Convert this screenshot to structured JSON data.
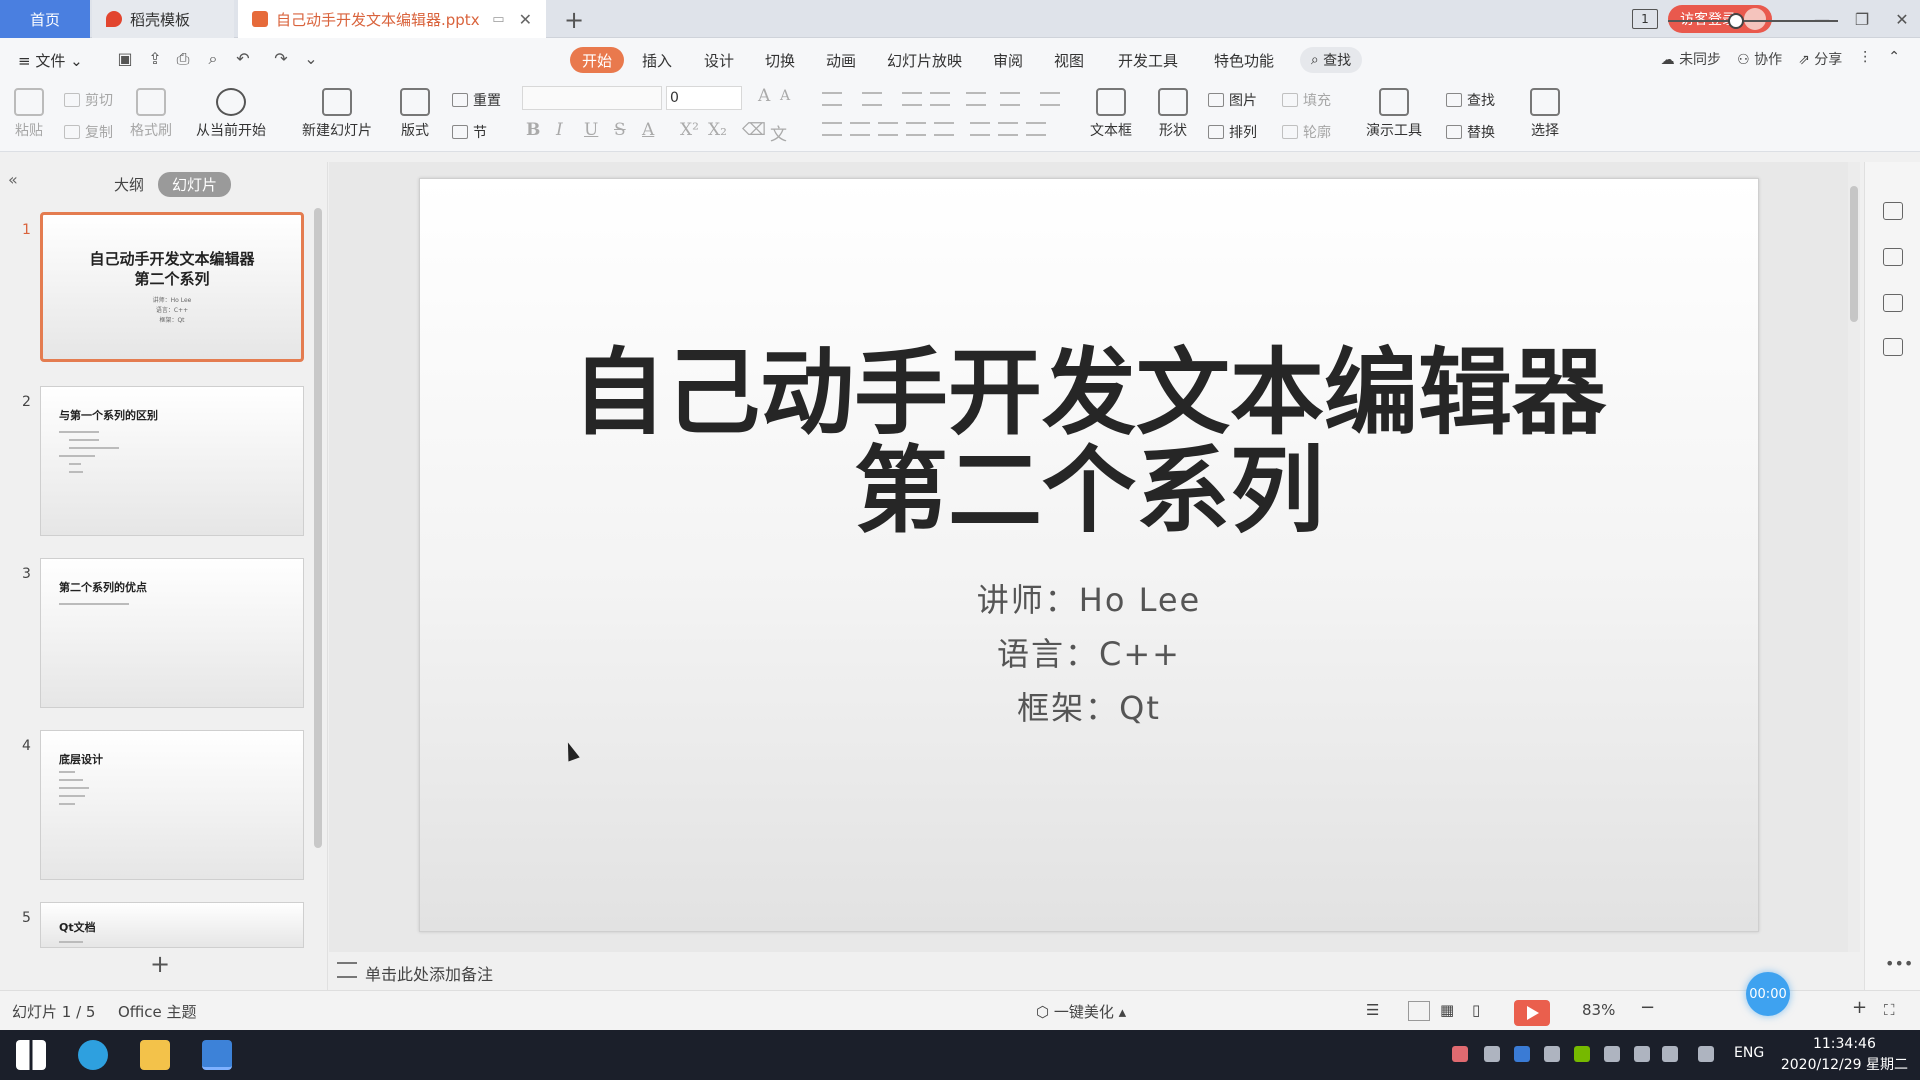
{
  "tabs": {
    "home": "首页",
    "template": "稻壳模板",
    "file": "自己动手开发文本编辑器.pptx",
    "window_badge": "1",
    "login": "访客登录"
  },
  "menu": {
    "file": "文件",
    "items": [
      "开始",
      "插入",
      "设计",
      "切换",
      "动画",
      "幻灯片放映",
      "审阅",
      "视图",
      "开发工具",
      "特色功能"
    ],
    "search": "查找",
    "right": [
      "未同步",
      "协作",
      "分享"
    ]
  },
  "ribbon": {
    "paste": "粘贴",
    "cut": "剪切",
    "copy": "复制",
    "format_painter": "格式刷",
    "from_current": "从当前开始",
    "new_slide": "新建幻灯片",
    "layout": "版式",
    "reset": "重置",
    "section": "节",
    "font_size": "0",
    "textbox": "文本框",
    "shape": "形状",
    "picture": "图片",
    "fill": "填充",
    "arrange": "排列",
    "outline": "轮廓",
    "present_tools": "演示工具",
    "find": "查找",
    "replace": "替换",
    "select": "选择"
  },
  "panel": {
    "tab_outline": "大纲",
    "tab_slides": "幻灯片",
    "thumbs": [
      {
        "num": "1",
        "title1": "自己动手开发文本编辑器",
        "title2": "第二个系列",
        "sub": [
          "讲师：Ho Lee",
          "语言：C++",
          "框架：Qt"
        ]
      },
      {
        "num": "2",
        "title": "与第一个系列的区别"
      },
      {
        "num": "3",
        "title": "第二个系列的优点"
      },
      {
        "num": "4",
        "title": "底层设计"
      },
      {
        "num": "5",
        "title": "Qt文档"
      }
    ]
  },
  "slide": {
    "title_line1": "自己动手开发文本编辑器",
    "title_line2": "第二个系列",
    "line1": "讲师：Ho Lee",
    "line2": "语言：C++",
    "line3": "框架：Qt"
  },
  "notes": {
    "placeholder": "单击此处添加备注"
  },
  "status": {
    "slide_info": "幻灯片 1 / 5",
    "theme": "Office 主题",
    "beautify": "一键美化",
    "zoom": "83%",
    "timer": "00:00"
  },
  "taskbar": {
    "lang": "ENG",
    "time": "11:34:46",
    "date": "2020/12/29 星期二"
  },
  "colors": {
    "accent": "#e9794d",
    "home_tab": "#4a7fe0",
    "login": "#e9594d",
    "play": "#ea5f4d",
    "timer": "#3ea2f0"
  }
}
